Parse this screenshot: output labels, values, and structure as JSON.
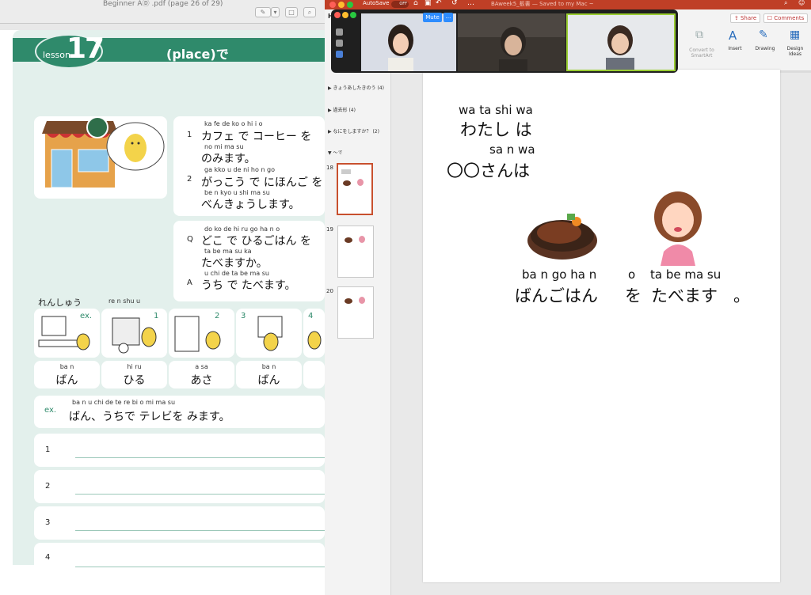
{
  "pdf": {
    "title": "Beginner AⒹ .pdf (page 26 of 29)",
    "lesson_word": "lesson",
    "lesson_number": "17",
    "lesson_title": "(place)で",
    "examples": [
      {
        "num": "1",
        "furi1": "ka  fe          de  ko o   hi  i o",
        "line1": "カフェ で コーヒー を",
        "furi2": "no  mi  ma  su",
        "line2": "のみます。"
      },
      {
        "num": "2",
        "furi1": "ga  kko  u        de   ni  ho  n  go",
        "line1": "がっこう で にほんご を",
        "furi2": "be   n   kyo  u  shi  ma  su",
        "line2": "べんきょうします。"
      }
    ],
    "qa": {
      "q_label": "Q",
      "q_furi1": "do  ko    de     hi    ru  go  ha  n   o",
      "q_line1": "どこ で ひるごはん を",
      "q_furi2": "ta  be  ma  su  ka",
      "q_line2": "たべますか。",
      "a_label": "A",
      "a_furi": "u   chi   de   ta   be  ma  su",
      "a_line": "うち で たべます。"
    },
    "practice_label": "れんしゅう",
    "practice_furi": "re n shu u",
    "practice_items": [
      {
        "tag": "ex.",
        "furi": "ba   n",
        "word": "ばん"
      },
      {
        "tag": "1",
        "furi": "hi   ru",
        "word": "ひる"
      },
      {
        "tag": "2",
        "furi": "a   sa",
        "word": "あさ"
      },
      {
        "tag": "3",
        "furi": "ba   n",
        "word": "ばん"
      },
      {
        "tag": "4",
        "furi": "",
        "word": ""
      }
    ],
    "example_sentence": {
      "tag": "ex.",
      "furi": "ba    n       u  chi  de   te  re  bi   o    mi  ma  su",
      "text": "ばん、うちで テレビを みます。"
    },
    "answer_lines": [
      "1",
      "2",
      "3",
      "4"
    ]
  },
  "zoom": {
    "mute_label": "Mute",
    "more_label": "...",
    "participants": [
      "participant-1",
      "participant-2",
      "participant-3"
    ]
  },
  "ppt": {
    "autosave_label": "AutoSave",
    "autosave_state": "OFF",
    "doc_title": "BAweek5_板書 — Saved to my Mac ~",
    "tab_initial": "H",
    "share_label": "Share",
    "comments_label": "Comments",
    "ribbon_buttons": [
      {
        "label": "Convert to SmartArt",
        "line1": "Convert to",
        "line2": "SmartArt"
      },
      {
        "label": "Insert",
        "line1": "Insert",
        "line2": ""
      },
      {
        "label": "Drawing",
        "line1": "Drawing",
        "line2": ""
      },
      {
        "label": "Design Ideas",
        "line1": "Design",
        "line2": "Ideas"
      }
    ],
    "sections": [
      "きょうあしたきのう (4)",
      "過去形 (4)",
      "なにをしますか？ (2)",
      "〜で"
    ],
    "slide_numbers": [
      "18",
      "19",
      "20"
    ],
    "slide": {
      "rom1": "wa ta shi wa",
      "jp1": "わたし は",
      "rom2": "sa n wa",
      "jp2": "〇〇さんは",
      "rom3": "ba n go ha n",
      "rom4": "o",
      "rom5": "ta be ma su",
      "jp3": "ばんごはん",
      "jp4": "を",
      "jp5": "たべます",
      "jp6": "。"
    }
  },
  "colors": {
    "lesson_green": "#2f8a6b",
    "page_mint": "#e3f0ec",
    "ppt_red": "#bf3f26",
    "zoom_bg": "#1f1f1f",
    "mute_blue": "#2d8cff"
  }
}
